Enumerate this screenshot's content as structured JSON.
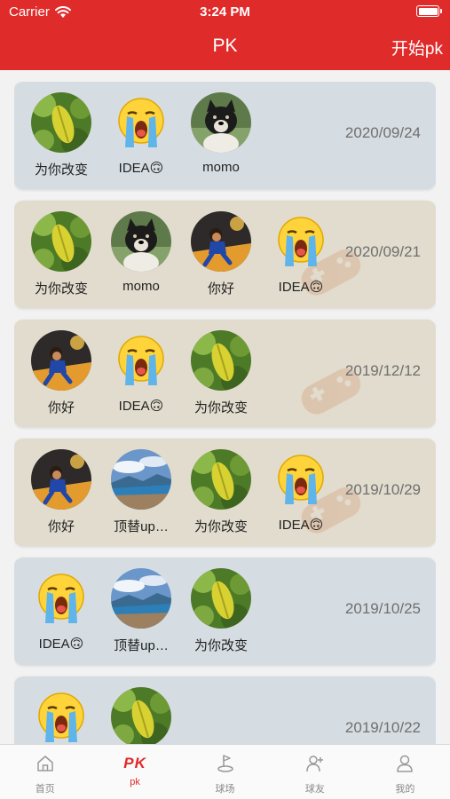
{
  "status_bar": {
    "carrier": "Carrier",
    "time": "3:24 PM"
  },
  "nav": {
    "title": "PK",
    "action_label": "开始pk"
  },
  "matches": [
    {
      "theme": "blue",
      "date": "2020/09/24",
      "players": [
        {
          "name": "为你改变",
          "avatar": "leaf"
        },
        {
          "name": "IDEA🙃",
          "avatar": "crying-emoji"
        },
        {
          "name": "momo",
          "avatar": "dog"
        }
      ]
    },
    {
      "theme": "tan",
      "date": "2020/09/21",
      "players": [
        {
          "name": "为你改变",
          "avatar": "leaf"
        },
        {
          "name": "momo",
          "avatar": "dog"
        },
        {
          "name": "你好",
          "avatar": "kid"
        },
        {
          "name": "IDEA🙃",
          "avatar": "crying-emoji"
        }
      ]
    },
    {
      "theme": "tan",
      "date": "2019/12/12",
      "players": [
        {
          "name": "你好",
          "avatar": "kid"
        },
        {
          "name": "IDEA🙃",
          "avatar": "crying-emoji"
        },
        {
          "name": "为你改变",
          "avatar": "leaf"
        }
      ]
    },
    {
      "theme": "tan",
      "date": "2019/10/29",
      "players": [
        {
          "name": "你好",
          "avatar": "kid"
        },
        {
          "name": "顶替up…",
          "avatar": "landscape"
        },
        {
          "name": "为你改变",
          "avatar": "leaf"
        },
        {
          "name": "IDEA🙃",
          "avatar": "crying-emoji"
        }
      ]
    },
    {
      "theme": "blue",
      "date": "2019/10/25",
      "players": [
        {
          "name": "IDEA🙃",
          "avatar": "crying-emoji"
        },
        {
          "name": "顶替up…",
          "avatar": "landscape"
        },
        {
          "name": "为你改变",
          "avatar": "leaf"
        }
      ]
    },
    {
      "theme": "blue",
      "date": "2019/10/22",
      "players": [
        {
          "name": "",
          "avatar": "crying-emoji"
        },
        {
          "name": "",
          "avatar": "leaf"
        }
      ]
    }
  ],
  "tabbar": {
    "active": "pk",
    "items": [
      {
        "id": "home",
        "label": "首页",
        "icon": "home-icon"
      },
      {
        "id": "pk",
        "label": "pk",
        "icon": "pk-logo",
        "logo_text": "PK"
      },
      {
        "id": "court",
        "label": "球场",
        "icon": "court-icon"
      },
      {
        "id": "friends",
        "label": "球友",
        "icon": "add-friend-icon"
      },
      {
        "id": "mine",
        "label": "我的",
        "icon": "person-icon"
      }
    ]
  },
  "colors": {
    "brand": "#e02b2b",
    "card_blue": "#d6dde2",
    "card_tan": "#e1dccd"
  }
}
